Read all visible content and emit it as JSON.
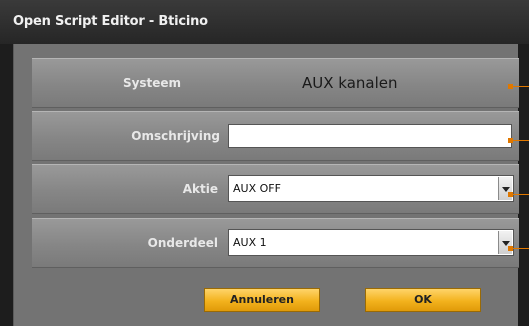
{
  "window": {
    "title": "Open Script Editor - Bticino"
  },
  "form": {
    "systeem": {
      "label": "Systeem",
      "value": "AUX kanalen"
    },
    "omschrijving": {
      "label": "Omschrijving",
      "value": "",
      "placeholder": ""
    },
    "aktie": {
      "label": "Aktie",
      "value": "AUX OFF"
    },
    "onderdeel": {
      "label": "Onderdeel",
      "value": "AUX 1"
    }
  },
  "buttons": {
    "cancel": "Annuleren",
    "ok": "OK"
  },
  "colors": {
    "accent": "#e07800",
    "button": "#f3b21d"
  }
}
